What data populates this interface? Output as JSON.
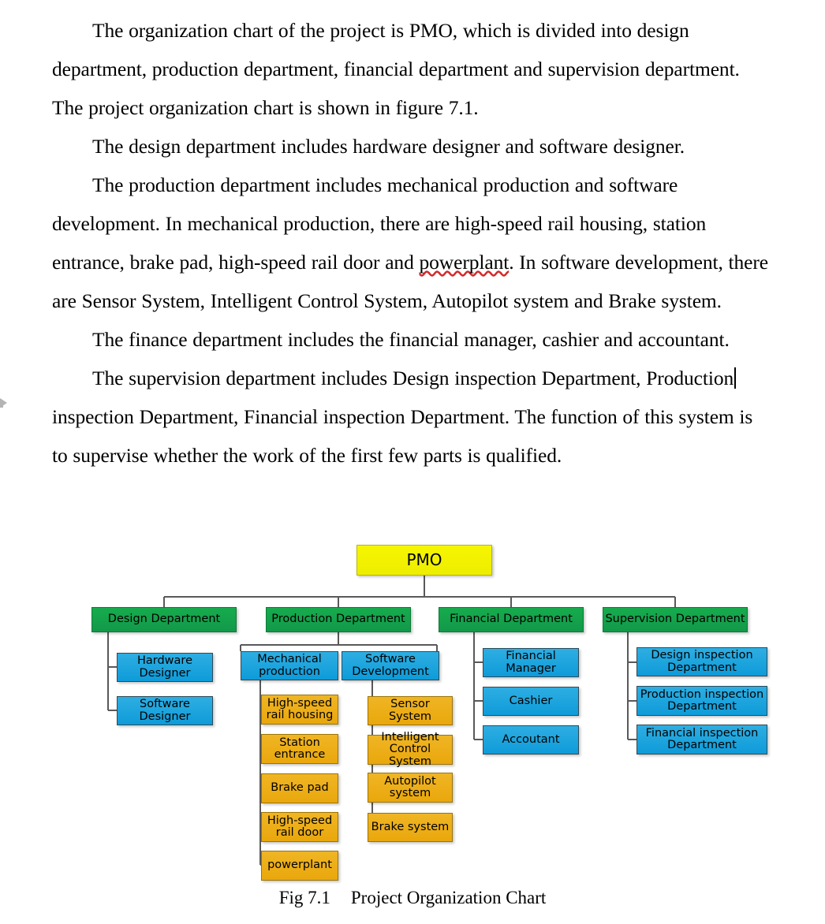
{
  "document": {
    "paragraphs": [
      {
        "id": "p1",
        "text": "The organization chart of the project is PMO, which is divided into design department, production department, financial department and supervision department. The project organization chart is shown in figure 7.1."
      },
      {
        "id": "p2",
        "text": "The design department includes hardware designer and software designer."
      },
      {
        "id": "p3a",
        "text": "The production department includes mechanical production and software development. In mechanical production, there are high-speed rail housing, station entrance, brake pad, high-speed rail door and "
      },
      {
        "id": "p3-misspelled",
        "text": "powerplant"
      },
      {
        "id": "p3b",
        "text": ". In software development, there are Sensor System, Intelligent Control System, Autopilot system and Brake system."
      },
      {
        "id": "p4",
        "text": "The finance department includes the financial manager, cashier and accountant."
      },
      {
        "id": "p5a",
        "text": "The supervision department includes Design inspection Department, Production"
      },
      {
        "id": "p5b",
        "text": "inspection Department, Financial inspection Department. The function of this system is to supervise whether the work of the first few parts is qualified."
      }
    ]
  },
  "figure": {
    "caption_label": "Fig 7.1",
    "caption_title": "Project Organization Chart"
  },
  "chart_data": {
    "type": "diagram",
    "title": "Project Organization Chart",
    "colors": {
      "root": "#f2f200",
      "department": "#16a94c",
      "subunit_blue": "#13a0dc",
      "subunit_orange": "#efae18",
      "connector": "#595959"
    },
    "root": {
      "label": "PMO"
    },
    "departments": [
      {
        "label": "Design Department",
        "children": [
          {
            "label": "Hardware Designer",
            "color": "blue"
          },
          {
            "label": "Software Designer",
            "color": "blue"
          }
        ]
      },
      {
        "label": "Production Department",
        "children": [
          {
            "label": "Mechanical production",
            "color": "blue",
            "children": [
              {
                "label": "High-speed rail housing",
                "color": "orange"
              },
              {
                "label": "Station entrance",
                "color": "orange"
              },
              {
                "label": "Brake pad",
                "color": "orange"
              },
              {
                "label": "High-speed rail door",
                "color": "orange"
              },
              {
                "label": "powerplant",
                "color": "orange"
              }
            ]
          },
          {
            "label": "Software Development",
            "color": "blue",
            "children": [
              {
                "label": "Sensor System",
                "color": "orange"
              },
              {
                "label": "Intelligent Control System",
                "color": "orange"
              },
              {
                "label": "Autopilot system",
                "color": "orange"
              },
              {
                "label": "Brake system",
                "color": "orange"
              }
            ]
          }
        ]
      },
      {
        "label": "Financial Department",
        "children": [
          {
            "label": "Financial Manager",
            "color": "blue"
          },
          {
            "label": "Cashier",
            "color": "blue"
          },
          {
            "label": "Accoutant",
            "color": "blue"
          }
        ]
      },
      {
        "label": "Supervision Department",
        "children": [
          {
            "label": "Design inspection Department",
            "color": "blue"
          },
          {
            "label": "Production inspection Department",
            "color": "blue"
          },
          {
            "label": "Financial inspection Department",
            "color": "blue"
          }
        ]
      }
    ]
  },
  "nodes": {
    "pmo": "PMO",
    "design_department": "Design Department",
    "production_department": "Production Department",
    "financial_department": "Financial Department",
    "supervision_department": "Supervision Department",
    "hardware_designer": "Hardware\nDesigner",
    "software_designer": "Software\nDesigner",
    "mechanical_production": "Mechanical\nproduction",
    "software_development": "Software\nDevelopment",
    "high_speed_rail_housing": "High-speed\nrail housing",
    "station_entrance": "Station\nentrance",
    "brake_pad": "Brake pad",
    "high_speed_rail_door": "High-speed\nrail door",
    "powerplant": "powerplant",
    "sensor_system": "Sensor System",
    "intelligent_control_system": "Intelligent\nControl System",
    "autopilot_system": "Autopilot\nsystem",
    "brake_system": "Brake system",
    "financial_manager": "Financial\nManager",
    "cashier": "Cashier",
    "accoutant": "Accoutant",
    "design_inspection_department": "Design inspection\nDepartment",
    "production_inspection_department": "Production inspection\nDepartment",
    "financial_inspection_department": "Financial inspection\nDepartment"
  }
}
